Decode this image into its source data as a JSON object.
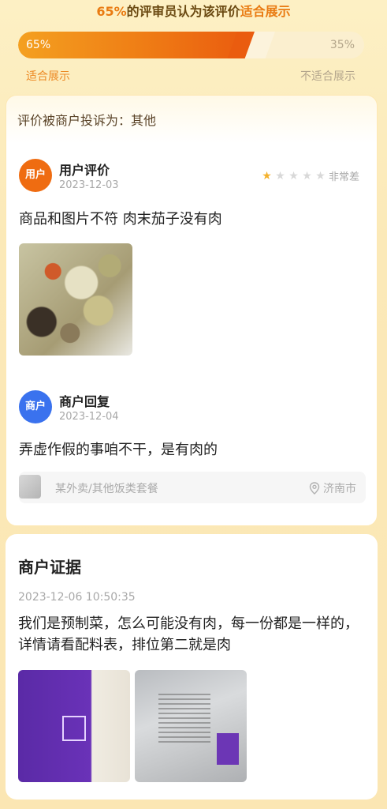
{
  "header": {
    "percent": "65%",
    "middle_text": "的评审员认为该评价",
    "verdict": "适合展示"
  },
  "vote": {
    "suitable_pct_label": "65%",
    "unsuitable_pct_label": "35%",
    "suitable_fraction": 0.65,
    "suitable_label": "适合展示",
    "unsuitable_label": "不适合展示"
  },
  "complaint": {
    "text": "评价被商户投诉为：其他"
  },
  "user_review": {
    "avatar_label": "用户",
    "title": "用户评价",
    "date": "2023-12-03",
    "rating": 1,
    "rating_max": 5,
    "rating_text": "非常差",
    "content": "商品和图片不符 肉末茄子没有肉"
  },
  "merchant_reply": {
    "avatar_label": "商户",
    "title": "商户回复",
    "date": "2023-12-04",
    "content": "弄虚作假的事咱不干，是有肉的"
  },
  "store": {
    "name": "某外卖/其他饭类套餐",
    "location": "济南市"
  },
  "evidence": {
    "title": "商户证据",
    "time": "2023-12-06 10:50:35",
    "content": "我们是预制菜，怎么可能没有肉，每一份都是一样的，详情请看配料表，排位第二就是肉"
  },
  "colors": {
    "accent_orange": "#ef7d15",
    "merchant_blue": "#3a72ee",
    "star_gold": "#f4b12c"
  }
}
